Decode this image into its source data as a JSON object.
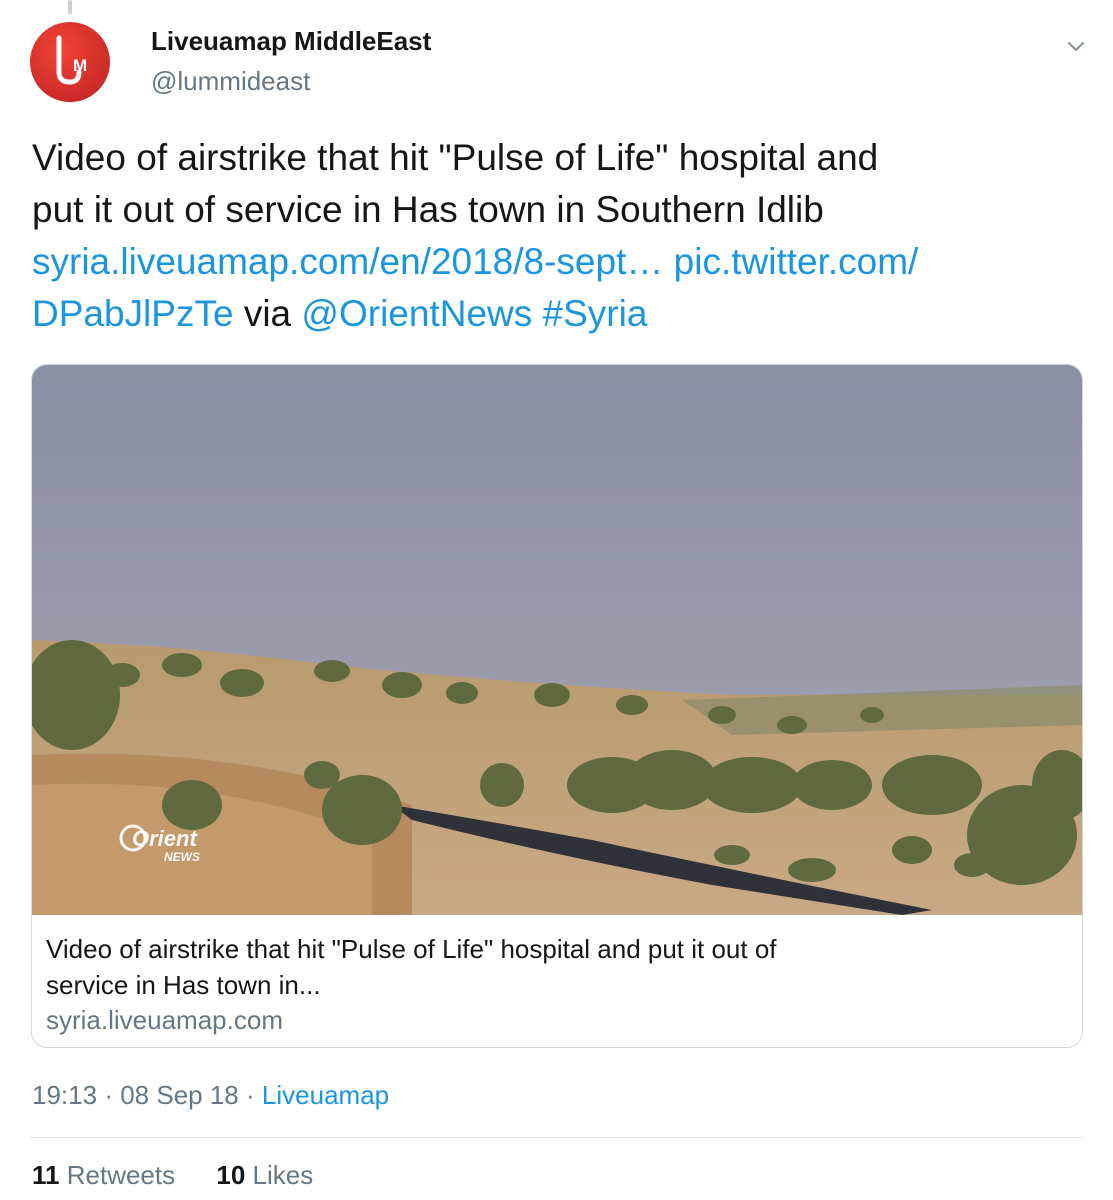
{
  "author": {
    "display_name": "Liveuamap MiddleEast",
    "handle": "@lummideast",
    "avatar_letters": "LM",
    "avatar_color": "#e53935"
  },
  "tweet": {
    "line1": "Video of airstrike that hit \"Pulse of Life\" hospital and",
    "line2": "put it out of service in Has town in Southern Idlib",
    "link_url": "syria.liveuamap.com/en/2018/8-sept…",
    "pic_link_part1": "pic.twitter.com/",
    "pic_link_part2": "DPabJlPzTe",
    "via_text": "via",
    "mention": "@OrientNews",
    "hashtag": "#Syria"
  },
  "card": {
    "watermark_main": "Orient",
    "watermark_sub": "NEWS",
    "title_line1": "Video of airstrike that hit \"Pulse of Life\" hospital and put it out of",
    "title_line2": "service in Has town in...",
    "domain": "syria.liveuamap.com"
  },
  "meta": {
    "time": "19:13",
    "date": "08 Sep 18",
    "source": "Liveuamap",
    "separator": "·"
  },
  "stats": {
    "retweets_count": "11",
    "retweets_label": "Retweets",
    "likes_count": "10",
    "likes_label": "Likes"
  },
  "colors": {
    "link": "#1b95e0",
    "secondary_text": "#657786",
    "primary_text": "#14171a",
    "border": "#ccd6dd"
  },
  "icons": {
    "caret": "chevron-down-icon"
  }
}
